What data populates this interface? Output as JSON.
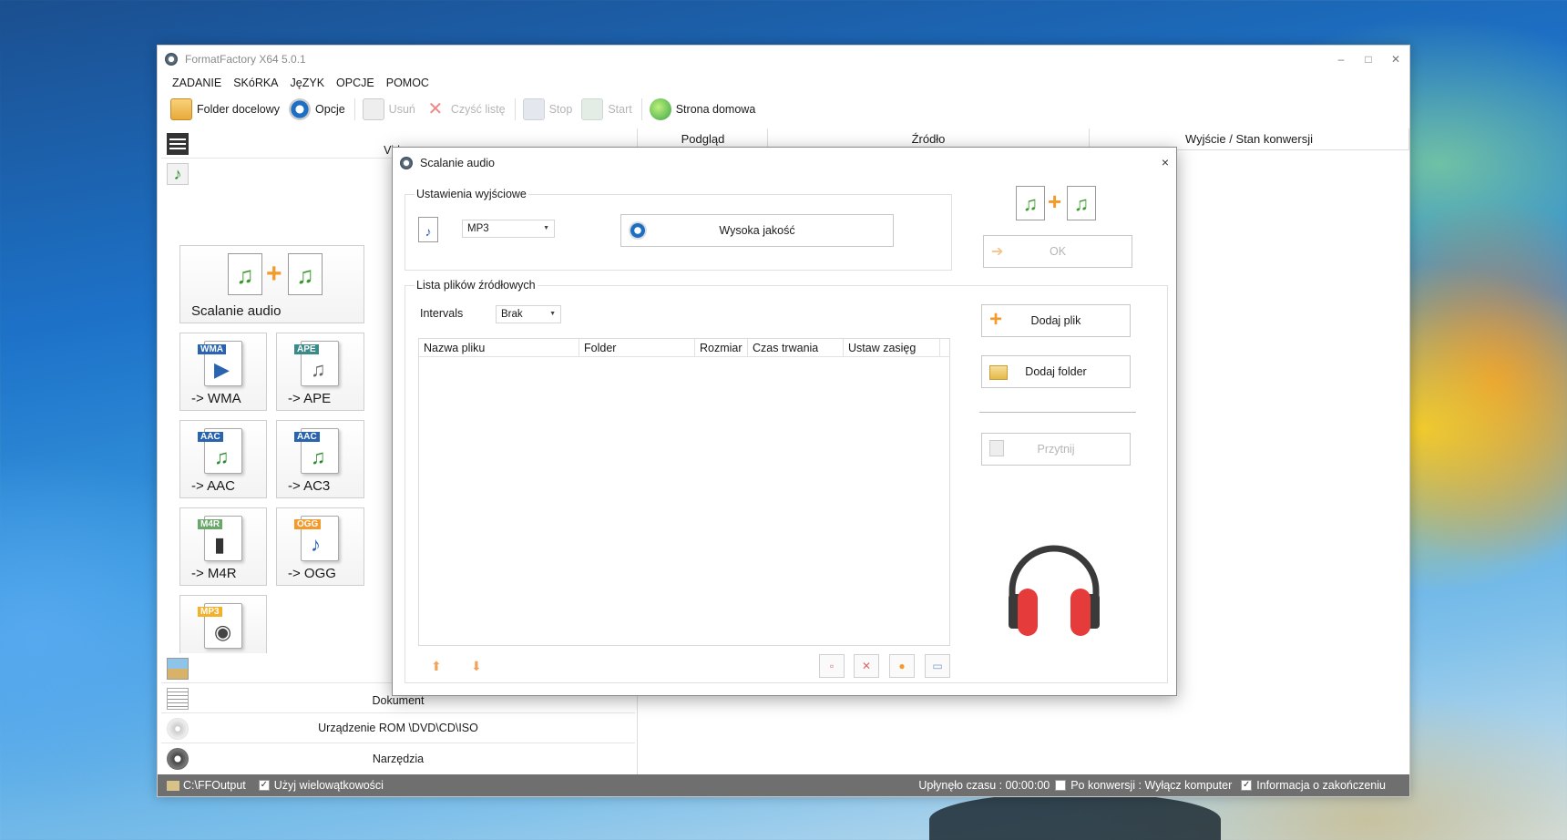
{
  "window": {
    "title": "FormatFactory X64 5.0.1",
    "controls": [
      "–",
      "□",
      "✕"
    ]
  },
  "menu": [
    "ZADANIE",
    "SKóRKA",
    "JęZYK",
    "OPCJE",
    "POMOC"
  ],
  "toolbar": {
    "folder": "Folder docelowy",
    "options": "Opcje",
    "remove": "Usuń",
    "clear": "Czyść listę",
    "stop": "Stop",
    "start": "Start",
    "home": "Strona domowa"
  },
  "left_panel": {
    "video": "Video",
    "tiles": {
      "merge": "Scalanie audio",
      "wma": "-> WMA",
      "ape": "-> APE",
      "aac": "-> AAC",
      "ac3": "-> AC3",
      "m4r": "-> M4R",
      "ogg": "-> OGG"
    },
    "tile_tags": {
      "wma": "WMA",
      "ape": "APE",
      "aac": "AAC",
      "ac3": "AAC",
      "m4r": "M4R",
      "ogg": "OGG",
      "mp3": "MP3"
    },
    "document": "Dokument",
    "rom": "Urządzenie ROM \\DVD\\CD\\ISO",
    "tools": "Narzędzia"
  },
  "task_header": {
    "preview": "Podgląd",
    "source": "Źródło",
    "output": "Wyjście / Stan konwersji"
  },
  "dialog": {
    "title": "Scalanie audio",
    "close": "×",
    "output_settings": "Ustawienia wyjściowe",
    "format": "MP3",
    "quality": "Wysoka jakość",
    "ok": "OK",
    "source_list": "Lista plików źródłowych",
    "intervals_label": "Intervals",
    "intervals_value": "Brak",
    "columns": [
      "Nazwa pliku",
      "Folder",
      "Rozmiar",
      "Czas trwania",
      "Ustaw zasięg"
    ],
    "add_file": "Dodaj plik",
    "add_folder": "Dodaj folder",
    "trim": "Przytnij"
  },
  "status": {
    "output_path": "C:\\FFOutput",
    "multithread": "Użyj wielowątkowości",
    "elapsed": "Upłynęło czasu : 00:00:00",
    "shutdown": "Po konwersji : Wyłącz komputer",
    "notify": "Informacja o zakończeniu"
  },
  "colors": {
    "accent_orange": "#f39a2b",
    "headphone_red": "#e63b3b",
    "status_bg": "#6f6f6f"
  }
}
